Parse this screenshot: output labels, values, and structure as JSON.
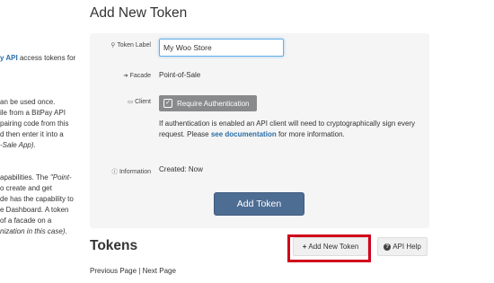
{
  "sidebar": {
    "lines": [
      {
        "pre": "",
        "link": "y API",
        "post": " access tokens for"
      },
      {
        "pre": "",
        "link": "",
        "post": ""
      },
      {
        "pre": "",
        "link": "",
        "post": ""
      },
      {
        "pre": "an be used once.",
        "link": "",
        "post": ""
      },
      {
        "pre": "ile from a BitPay API",
        "link": "",
        "post": ""
      },
      {
        "pre": "pairing code from this",
        "link": "",
        "post": ""
      },
      {
        "pre": "d then enter it into a",
        "link": "",
        "post": ""
      },
      {
        "pre": "",
        "ital": "-Sale App)",
        "post": "."
      },
      {
        "pre": "",
        "link": "",
        "post": ""
      },
      {
        "pre": "apabilities.  The ",
        "ital": "\"Point-",
        "post": ""
      },
      {
        "pre": "o create and get",
        "link": "",
        "post": ""
      },
      {
        "pre": "de has the capability to",
        "link": "",
        "post": ""
      },
      {
        "pre": "e Dashboard.  A token",
        "link": "",
        "post": ""
      },
      {
        "pre": "of a facade on a",
        "link": "",
        "post": ""
      },
      {
        "pre": "",
        "ital": "nization in this case)",
        "post": "."
      }
    ]
  },
  "page_title": "Add New Token",
  "form": {
    "token_label": {
      "label": "Token Label",
      "icon": "tag-icon",
      "value": "My Woo Store"
    },
    "facade": {
      "label": "Facade",
      "icon": "login-icon",
      "value": "Point-of-Sale"
    },
    "client": {
      "label": "Client",
      "icon": "laptop-icon",
      "button": "Require Authentication",
      "desc_pre": "If authentication is enabled an API client will need to cryptographically sign every request. Please ",
      "desc_link": "see documentation",
      "desc_post": " for more information."
    },
    "information": {
      "label": "Information",
      "icon": "info-icon",
      "value": "Created: Now"
    },
    "submit": "Add Token"
  },
  "tokens": {
    "title": "Tokens",
    "add_button": "Add New Token",
    "help_button": "API Help",
    "prev": "Previous Page",
    "separator": " | ",
    "next": "Next Page"
  },
  "colors": {
    "primary_button": "#4e6d93",
    "highlight": "#d0021b",
    "link": "#2a6fa8"
  }
}
